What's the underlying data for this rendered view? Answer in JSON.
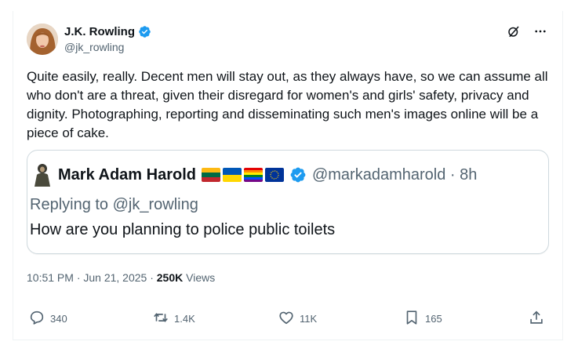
{
  "author": {
    "name": "J.K. Rowling",
    "handle": "@jk_rowling",
    "verified_color": "#1d9bf0"
  },
  "tweet": {
    "text": "Quite easily, really. Decent men will stay out, as they always have, so we can assume all who don't are a threat, given their disregard for women's and girls' safety, privacy and dignity. Photographing, reporting and disseminating such men's images online will be a piece of cake."
  },
  "quoted": {
    "name": "Mark Adam Harold",
    "flags": [
      "lithuania-flag",
      "ukraine-flag",
      "rainbow-flag",
      "eu-flag"
    ],
    "handle_time": "@markadamharold · 8h",
    "replying_to": "Replying to @jk_rowling",
    "text": "How are you planning to police public toilets"
  },
  "meta": {
    "timestamp": "10:51 PM · Jun 21, 2025 · ",
    "views_count": "250K",
    "views_label": " Views"
  },
  "actions": {
    "replies": "340",
    "reposts": "1.4K",
    "likes": "11K",
    "bookmarks": "165"
  },
  "icons": [
    "grok-icon",
    "more-icon",
    "reply-icon",
    "repost-icon",
    "like-icon",
    "bookmark-icon",
    "share-icon",
    "verified-badge-icon"
  ]
}
